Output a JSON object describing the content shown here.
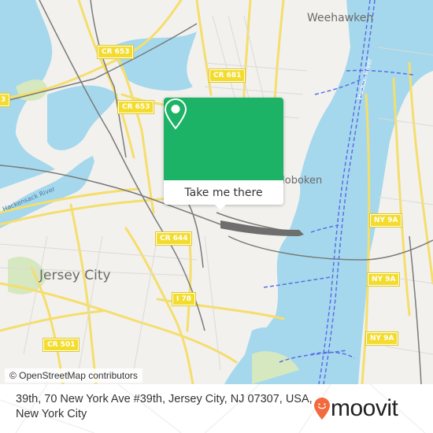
{
  "map": {
    "labels": {
      "weehawken": "Weehawken",
      "hoboken": "Hoboken",
      "jersey_city": "Jersey City",
      "hackensack_river": "Hackensack River",
      "hudson_river": "Hudson River"
    },
    "shields": {
      "cr653_a": "CR 653",
      "cr653_b": "CR 653",
      "cr681": "CR 681",
      "cr644": "CR 644",
      "i78": "I 78",
      "cr501": "CR 501",
      "ny9a_a": "NY 9A",
      "ny9a_b": "NY 9A",
      "ny9a_c": "NY 9A",
      "left_edge": "3"
    },
    "colors": {
      "land": "#f2f1ee",
      "water": "#a5d8ec",
      "road": "#f5de6c",
      "park": "#d5e8bf",
      "ferry": "#5a6ee8",
      "rail": "#7a7a7a"
    },
    "attribution": "© OpenStreetMap contributors"
  },
  "popup": {
    "icon": "map-pin-icon",
    "button_label": "Take me there",
    "color": "#1db366"
  },
  "footer": {
    "address": "39th, 70 New York Ave #39th, Jersey City, NJ 07307, USA, New York City",
    "brand": "moovit",
    "brand_color": "#f26a3e"
  }
}
